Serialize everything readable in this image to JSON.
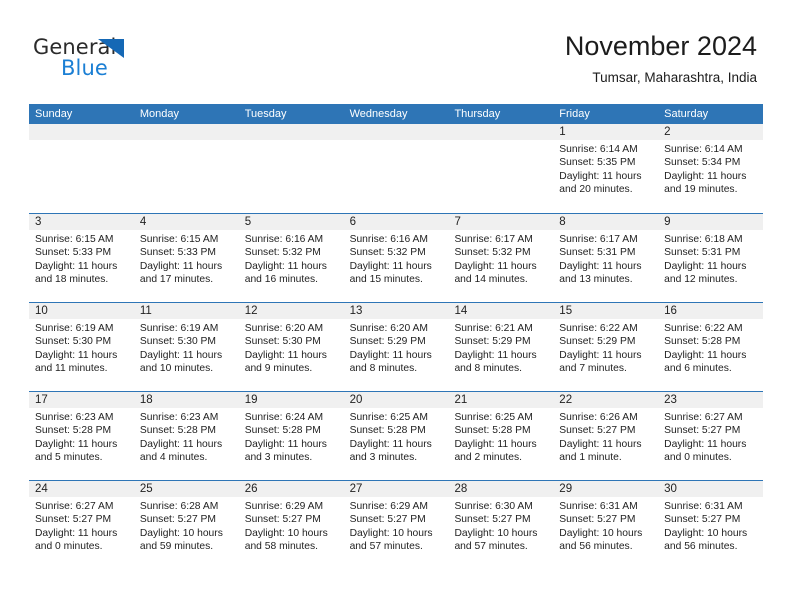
{
  "brand": {
    "name_part1": "General",
    "name_part2": "Blue",
    "accent_color": "#1b7fd4",
    "triangle_color": "#1568b5"
  },
  "header": {
    "title": "November 2024",
    "subtitle": "Tumsar, Maharashtra, India",
    "header_blue": "#2e75b6"
  },
  "weekdays": [
    "Sunday",
    "Monday",
    "Tuesday",
    "Wednesday",
    "Thursday",
    "Friday",
    "Saturday"
  ],
  "labels": {
    "sunrise": "Sunrise:",
    "sunset": "Sunset:",
    "daylight": "Daylight:"
  },
  "weeks": [
    [
      {
        "day": "",
        "sunrise": "",
        "sunset": "",
        "daylight": "",
        "empty": true
      },
      {
        "day": "",
        "sunrise": "",
        "sunset": "",
        "daylight": "",
        "empty": true
      },
      {
        "day": "",
        "sunrise": "",
        "sunset": "",
        "daylight": "",
        "empty": true
      },
      {
        "day": "",
        "sunrise": "",
        "sunset": "",
        "daylight": "",
        "empty": true
      },
      {
        "day": "",
        "sunrise": "",
        "sunset": "",
        "daylight": "",
        "empty": true
      },
      {
        "day": "1",
        "sunrise": "Sunrise: 6:14 AM",
        "sunset": "Sunset: 5:35 PM",
        "daylight": "Daylight: 11 hours and 20 minutes."
      },
      {
        "day": "2",
        "sunrise": "Sunrise: 6:14 AM",
        "sunset": "Sunset: 5:34 PM",
        "daylight": "Daylight: 11 hours and 19 minutes."
      }
    ],
    [
      {
        "day": "3",
        "sunrise": "Sunrise: 6:15 AM",
        "sunset": "Sunset: 5:33 PM",
        "daylight": "Daylight: 11 hours and 18 minutes."
      },
      {
        "day": "4",
        "sunrise": "Sunrise: 6:15 AM",
        "sunset": "Sunset: 5:33 PM",
        "daylight": "Daylight: 11 hours and 17 minutes."
      },
      {
        "day": "5",
        "sunrise": "Sunrise: 6:16 AM",
        "sunset": "Sunset: 5:32 PM",
        "daylight": "Daylight: 11 hours and 16 minutes."
      },
      {
        "day": "6",
        "sunrise": "Sunrise: 6:16 AM",
        "sunset": "Sunset: 5:32 PM",
        "daylight": "Daylight: 11 hours and 15 minutes."
      },
      {
        "day": "7",
        "sunrise": "Sunrise: 6:17 AM",
        "sunset": "Sunset: 5:32 PM",
        "daylight": "Daylight: 11 hours and 14 minutes."
      },
      {
        "day": "8",
        "sunrise": "Sunrise: 6:17 AM",
        "sunset": "Sunset: 5:31 PM",
        "daylight": "Daylight: 11 hours and 13 minutes."
      },
      {
        "day": "9",
        "sunrise": "Sunrise: 6:18 AM",
        "sunset": "Sunset: 5:31 PM",
        "daylight": "Daylight: 11 hours and 12 minutes."
      }
    ],
    [
      {
        "day": "10",
        "sunrise": "Sunrise: 6:19 AM",
        "sunset": "Sunset: 5:30 PM",
        "daylight": "Daylight: 11 hours and 11 minutes."
      },
      {
        "day": "11",
        "sunrise": "Sunrise: 6:19 AM",
        "sunset": "Sunset: 5:30 PM",
        "daylight": "Daylight: 11 hours and 10 minutes."
      },
      {
        "day": "12",
        "sunrise": "Sunrise: 6:20 AM",
        "sunset": "Sunset: 5:30 PM",
        "daylight": "Daylight: 11 hours and 9 minutes."
      },
      {
        "day": "13",
        "sunrise": "Sunrise: 6:20 AM",
        "sunset": "Sunset: 5:29 PM",
        "daylight": "Daylight: 11 hours and 8 minutes."
      },
      {
        "day": "14",
        "sunrise": "Sunrise: 6:21 AM",
        "sunset": "Sunset: 5:29 PM",
        "daylight": "Daylight: 11 hours and 8 minutes."
      },
      {
        "day": "15",
        "sunrise": "Sunrise: 6:22 AM",
        "sunset": "Sunset: 5:29 PM",
        "daylight": "Daylight: 11 hours and 7 minutes."
      },
      {
        "day": "16",
        "sunrise": "Sunrise: 6:22 AM",
        "sunset": "Sunset: 5:28 PM",
        "daylight": "Daylight: 11 hours and 6 minutes."
      }
    ],
    [
      {
        "day": "17",
        "sunrise": "Sunrise: 6:23 AM",
        "sunset": "Sunset: 5:28 PM",
        "daylight": "Daylight: 11 hours and 5 minutes."
      },
      {
        "day": "18",
        "sunrise": "Sunrise: 6:23 AM",
        "sunset": "Sunset: 5:28 PM",
        "daylight": "Daylight: 11 hours and 4 minutes."
      },
      {
        "day": "19",
        "sunrise": "Sunrise: 6:24 AM",
        "sunset": "Sunset: 5:28 PM",
        "daylight": "Daylight: 11 hours and 3 minutes."
      },
      {
        "day": "20",
        "sunrise": "Sunrise: 6:25 AM",
        "sunset": "Sunset: 5:28 PM",
        "daylight": "Daylight: 11 hours and 3 minutes."
      },
      {
        "day": "21",
        "sunrise": "Sunrise: 6:25 AM",
        "sunset": "Sunset: 5:28 PM",
        "daylight": "Daylight: 11 hours and 2 minutes."
      },
      {
        "day": "22",
        "sunrise": "Sunrise: 6:26 AM",
        "sunset": "Sunset: 5:27 PM",
        "daylight": "Daylight: 11 hours and 1 minute."
      },
      {
        "day": "23",
        "sunrise": "Sunrise: 6:27 AM",
        "sunset": "Sunset: 5:27 PM",
        "daylight": "Daylight: 11 hours and 0 minutes."
      }
    ],
    [
      {
        "day": "24",
        "sunrise": "Sunrise: 6:27 AM",
        "sunset": "Sunset: 5:27 PM",
        "daylight": "Daylight: 11 hours and 0 minutes."
      },
      {
        "day": "25",
        "sunrise": "Sunrise: 6:28 AM",
        "sunset": "Sunset: 5:27 PM",
        "daylight": "Daylight: 10 hours and 59 minutes."
      },
      {
        "day": "26",
        "sunrise": "Sunrise: 6:29 AM",
        "sunset": "Sunset: 5:27 PM",
        "daylight": "Daylight: 10 hours and 58 minutes."
      },
      {
        "day": "27",
        "sunrise": "Sunrise: 6:29 AM",
        "sunset": "Sunset: 5:27 PM",
        "daylight": "Daylight: 10 hours and 57 minutes."
      },
      {
        "day": "28",
        "sunrise": "Sunrise: 6:30 AM",
        "sunset": "Sunset: 5:27 PM",
        "daylight": "Daylight: 10 hours and 57 minutes."
      },
      {
        "day": "29",
        "sunrise": "Sunrise: 6:31 AM",
        "sunset": "Sunset: 5:27 PM",
        "daylight": "Daylight: 10 hours and 56 minutes."
      },
      {
        "day": "30",
        "sunrise": "Sunrise: 6:31 AM",
        "sunset": "Sunset: 5:27 PM",
        "daylight": "Daylight: 10 hours and 56 minutes."
      }
    ]
  ]
}
